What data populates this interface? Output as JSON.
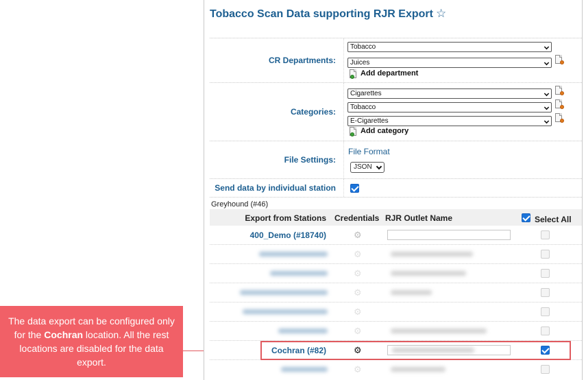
{
  "page": {
    "title": "Tobacco Scan Data supporting RJR Export",
    "star_icon": "☆"
  },
  "cr_departments": {
    "label": "CR Departments:",
    "selects": [
      "Tobacco",
      "Juices"
    ],
    "add_label": "Add department"
  },
  "categories": {
    "label": "Categories:",
    "selects": [
      "Cigarettes",
      "Tobacco",
      "E-Cigarettes"
    ],
    "add_label": "Add category"
  },
  "file_settings": {
    "label": "File Settings:",
    "format_label": "File Format",
    "format_value": "JSON"
  },
  "send_by_station": {
    "label": "Send data by individual station",
    "checked": true
  },
  "group": {
    "name": "Greyhound (#46)"
  },
  "table": {
    "headers": {
      "station": "Export from Stations",
      "credentials": "Credentials",
      "outlet": "RJR Outlet Name",
      "select_all": "Select All"
    },
    "rows": [
      {
        "station": "400_Demo (#18740)",
        "checked": false,
        "enabled": false
      },
      {
        "station": "",
        "checked": false,
        "enabled": false
      },
      {
        "station": "",
        "checked": false,
        "enabled": false
      },
      {
        "station": "",
        "checked": false,
        "enabled": false
      },
      {
        "station": "",
        "checked": false,
        "enabled": false
      },
      {
        "station": "",
        "checked": false,
        "enabled": false
      },
      {
        "station": "Cochran (#82)",
        "checked": true,
        "enabled": true
      },
      {
        "station": "",
        "checked": false,
        "enabled": false
      }
    ]
  },
  "callout": {
    "part1": "The data export can be configured only for the ",
    "bold": "Cochran",
    "part2": " location. All the rest locations are disabled for the data export."
  },
  "colors": {
    "accent": "#1d5f91",
    "callout_bg": "#f16067",
    "checkbox_on": "#1a73d9"
  }
}
